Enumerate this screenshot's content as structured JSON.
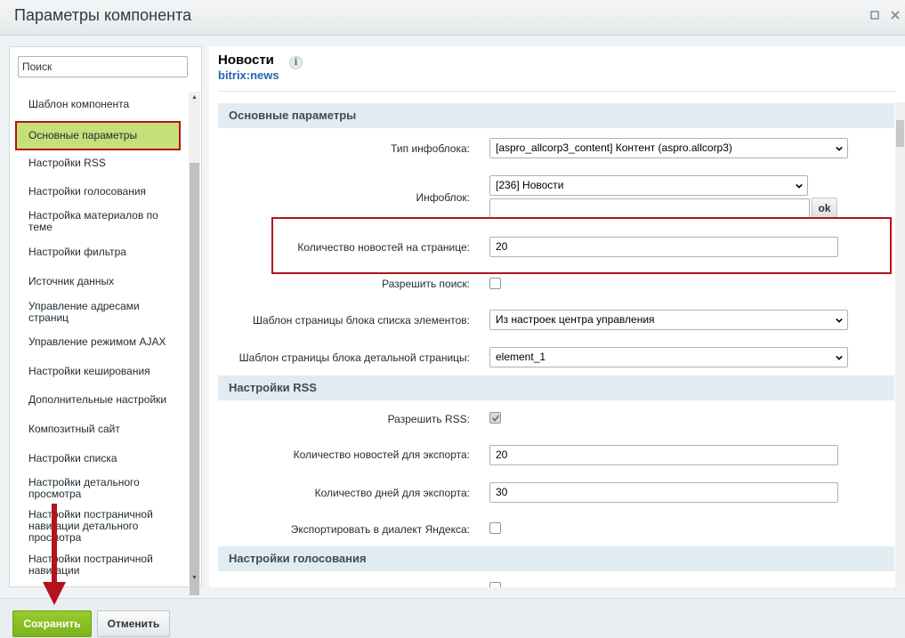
{
  "window": {
    "title": "Параметры компонента"
  },
  "sidebar": {
    "search_placeholder": "Поиск",
    "items": [
      {
        "label": "Шаблон компонента"
      },
      {
        "label": "Основные параметры"
      },
      {
        "label": "Настройки RSS"
      },
      {
        "label": "Настройки голосования"
      },
      {
        "label": "Настройка материалов по теме"
      },
      {
        "label": "Настройки фильтра"
      },
      {
        "label": "Источник данных"
      },
      {
        "label": "Управление адресами страниц"
      },
      {
        "label": "Управление режимом AJAX"
      },
      {
        "label": "Настройки кеширования"
      },
      {
        "label": "Дополнительные настройки"
      },
      {
        "label": "Композитный сайт"
      },
      {
        "label": "Настройки списка"
      },
      {
        "label": "Настройки детального просмотра"
      },
      {
        "label": "Настройки постраничной навигации детального просмотра"
      },
      {
        "label": "Настройки постраничной навигации"
      }
    ],
    "active_item": "Основные параметры"
  },
  "component": {
    "title": "Новости",
    "code": "bitrix:news",
    "info_glyph": "i"
  },
  "sections": {
    "main": {
      "title": "Основные параметры",
      "iblock_type_label": "Тип инфоблока:",
      "iblock_type_value": "[aspro_allcorp3_content] Контент (aspro.allcorp3)",
      "iblock_label": "Инфоблок:",
      "iblock_value": "[236] Новости",
      "iblock_extra_value": "",
      "ok_label": "ok",
      "news_count_label": "Количество новостей на странице:",
      "news_count_value": "20",
      "allow_search_label": "Разрешить поиск:",
      "list_template_label": "Шаблон страницы блока списка элементов:",
      "list_template_value": "Из настроек центра управления",
      "detail_template_label": "Шаблон страницы блока детальной страницы:",
      "detail_template_value": "element_1"
    },
    "rss": {
      "title": "Настройки RSS",
      "allow_rss_label": "Разрешить RSS:",
      "export_count_label": "Количество новостей для экспорта:",
      "export_count_value": "20",
      "export_days_label": "Количество дней для экспорта:",
      "export_days_value": "30",
      "yandex_label": "Экспортировать в диалект Яндекса:"
    },
    "voting": {
      "title": "Настройки голосования"
    }
  },
  "footer": {
    "save_label": "Сохранить",
    "cancel_label": "Отменить"
  },
  "colors": {
    "active_item_bg": "#c7df78",
    "highlight_border": "#b3131b",
    "save_button": "#8cc026",
    "link_blue": "#2067b0",
    "section_bg": "#e1ebf2"
  },
  "icons": {
    "minimize": "minimize-icon",
    "close": "close-icon",
    "info": "info-icon",
    "dropdown": "chevron-down-icon",
    "checkmark": "check-icon",
    "arrow": "arrow-down-icon"
  }
}
